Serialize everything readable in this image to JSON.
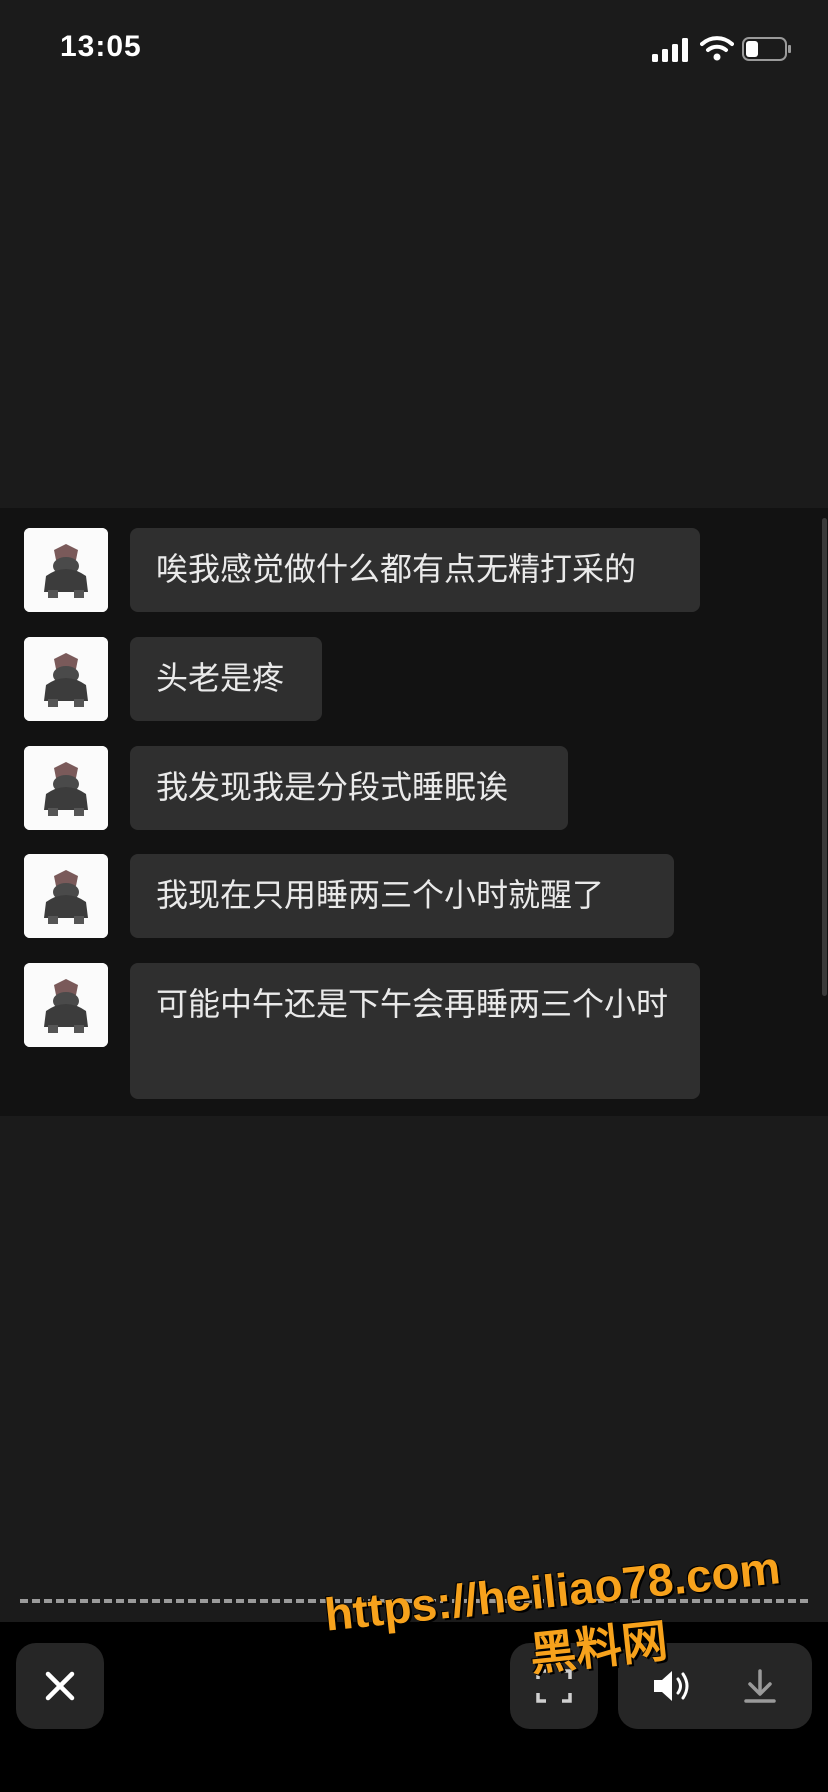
{
  "status_bar": {
    "time": "13:05"
  },
  "messages": [
    {
      "text": "唉我感觉做什么都有点无精打采的"
    },
    {
      "text": "头老是疼"
    },
    {
      "text": "我发现我是分段式睡眠诶"
    },
    {
      "text": "我现在只用睡两三个小时就醒了"
    },
    {
      "text": "可能中午还是下午会再睡两三个小时"
    }
  ],
  "toolbar": {
    "close_icon": "close-icon",
    "scan_icon": "scan-icon",
    "speaker_icon": "speaker-icon",
    "download_icon": "download-icon"
  },
  "watermark": {
    "url": "https://heiliao78.com",
    "name": "黑料网"
  }
}
